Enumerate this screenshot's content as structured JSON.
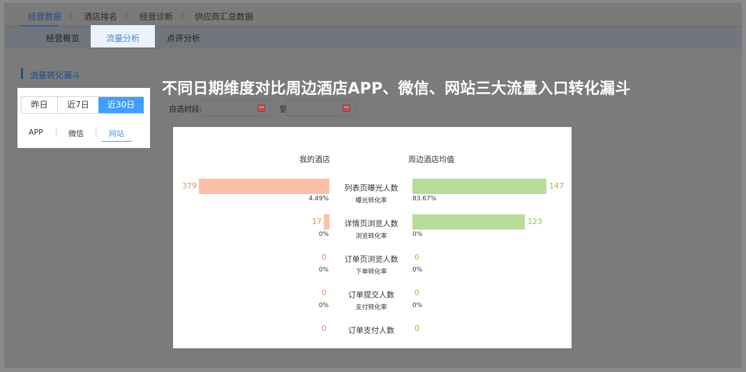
{
  "top_tabs": [
    "经营数据",
    "酒店排名",
    "经营诊断",
    "供应商汇总数据"
  ],
  "sub_tabs": [
    "经营概览",
    "流量分析",
    "点评分析"
  ],
  "section_title": "流量转化漏斗",
  "range_buttons": [
    "昨日",
    "近7日",
    "近30日"
  ],
  "channels": [
    "APP",
    "微信",
    "网站"
  ],
  "heading": "不同日期维度对比周边酒店APP、微信、网站三大流量入口转化漏斗",
  "custom_range": {
    "label": "自选时段:",
    "separator": "至",
    "start_value": "",
    "end_value": ""
  },
  "funnel": {
    "left_header": "我的酒店",
    "right_header": "周边酒店均值",
    "stages": [
      {
        "name": "列表页曝光人数",
        "mine": 379,
        "avg": 147,
        "rate_name": "曝光转化率",
        "mine_rate": "4.49%",
        "avg_rate": "83.67%"
      },
      {
        "name": "详情页浏览人数",
        "mine": 17,
        "avg": 123,
        "rate_name": "浏览转化率",
        "mine_rate": "0%",
        "avg_rate": "0%"
      },
      {
        "name": "订单页浏览人数",
        "mine": 0,
        "avg": 0,
        "rate_name": "下单转化率",
        "mine_rate": "0%",
        "avg_rate": "0%"
      },
      {
        "name": "订单提交人数",
        "mine": 0,
        "avg": 0,
        "rate_name": "支付转化率",
        "mine_rate": "0%",
        "avg_rate": "0%"
      },
      {
        "name": "订单支付人数",
        "mine": 0,
        "avg": 0
      }
    ],
    "colors": {
      "mine": "#fcc0a8",
      "avg": "#b9dc98",
      "mine_text": "#f08660",
      "avg_text": "#8bc34a"
    }
  }
}
